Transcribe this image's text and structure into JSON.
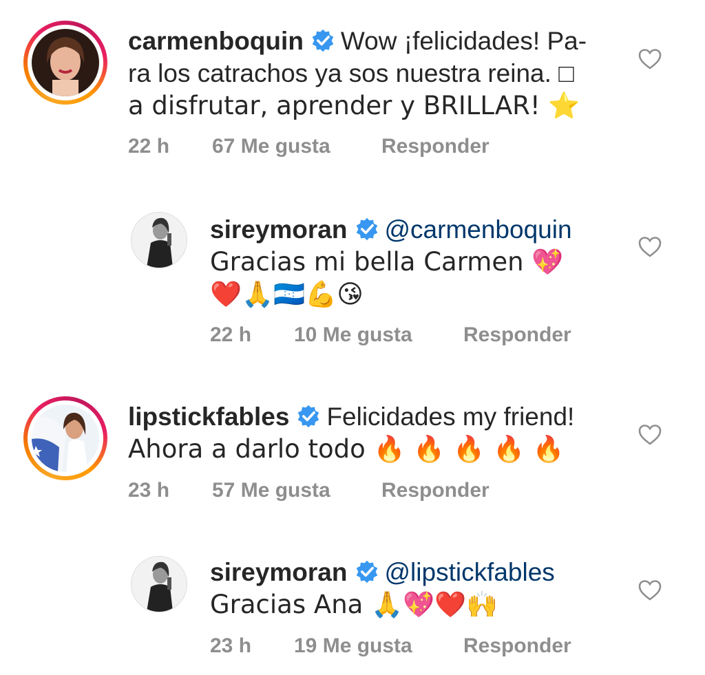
{
  "comments": [
    {
      "username": "carmenboquin",
      "mention": "",
      "text_lines": [
        "Wow ¡felicidades! Pa-",
        "ra los catrachos ya sos nuestra reina. □",
        "a disfrutar, aprender y BRILLAR! ⭐"
      ],
      "time": "22 h",
      "likes": "67 Me gusta",
      "reply": "Responder",
      "avatar_icon": "profile-photo-woman"
    },
    {
      "username": "sireymoran",
      "mention": "@carmenboquin",
      "text_lines": [
        "Gracias mi bella Carmen 💖",
        "❤️🙏🇭🇳💪😘"
      ],
      "time": "22 h",
      "likes": "10 Me gusta",
      "reply": "Responder",
      "avatar_icon": "profile-photo-bw"
    },
    {
      "username": "lipstickfables",
      "mention": "",
      "text_lines": [
        "Felicidades my friend!",
        "Ahora a darlo todo 🔥 🔥 🔥 🔥 🔥"
      ],
      "time": "23 h",
      "likes": "57 Me gusta",
      "reply": "Responder",
      "avatar_icon": "profile-photo-flag"
    },
    {
      "username": "sireymoran",
      "mention": "@lipstickfables",
      "text_lines": [
        "Gracias Ana 🙏💖❤️🙌"
      ],
      "time": "23 h",
      "likes": "19 Me gusta",
      "reply": "Responder",
      "avatar_icon": "profile-photo-bw"
    }
  ],
  "colors": {
    "text": "#262626",
    "meta": "#8e8e8e",
    "mention": "#00376b",
    "verified": "#3897f0"
  }
}
